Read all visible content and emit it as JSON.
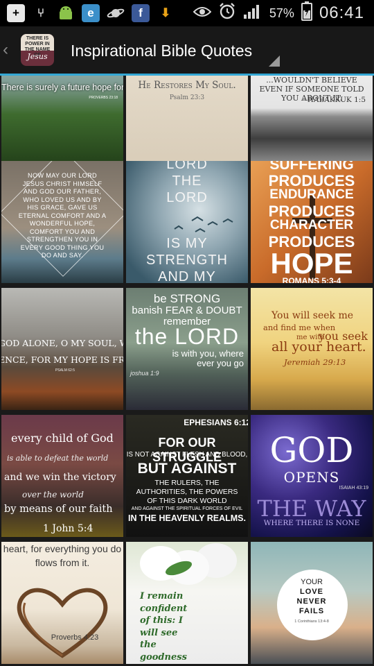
{
  "status_bar": {
    "icons_left": [
      "add-icon",
      "usb-icon",
      "android-debug-icon",
      "browser-icon",
      "planet-icon",
      "facebook-icon",
      "download-icon"
    ],
    "icons_right": [
      "eye-icon",
      "alarm-icon",
      "signal-icon",
      "battery-icon"
    ],
    "battery_percent": "57%",
    "time": "06:41"
  },
  "action_bar": {
    "logo_top": "THERE IS POWER IN THE NAME OF",
    "logo_bottom": "Jesus",
    "title": "Inspirational Bible Quotes"
  },
  "tiles": [
    {
      "t1": "There is surely a future hope for you",
      "t2": "PROVERBS 23:18"
    },
    {
      "t1": "He Restores My Soul.",
      "t2": "Psalm 23:3"
    },
    {
      "t1": "...WOULDN'T BELIEVE EVEN IF SOMEONE TOLD YOU ABOUT IT.",
      "t2": "- HABAKKUK 1:5"
    },
    {
      "t1": "NOW MAY OUR LORD JESUS CHRIST HIMSELF AND GOD OUR FATHER, WHO LOVED US AND BY HIS GRACE, GAVE US ETERNAL COMFORT AND A WONDERFUL HOPE, COMFORT YOU AND STRENGTHEN YOU IN EVERY GOOD THING YOU DO AND SAY."
    },
    {
      "t1": "LORD",
      "t2": "THE",
      "t3": "LORD",
      "t4": "IS MY",
      "t5": "STRENGTH",
      "t6": "AND MY"
    },
    {
      "t1": "SUFFERING",
      "t2": "PRODUCES",
      "t3": "ENDURANCE",
      "t4": "PRODUCES",
      "t5": "CHARACTER",
      "t6": "PRODUCES",
      "t7": "HOPE",
      "t8": "ROMANS 5:3-4"
    },
    {
      "t1": "GOD ALONE, O MY SOUL, WAIT",
      "t2": "ENCE, FOR MY HOPE IS FROM",
      "t3": "PSALM 62:5"
    },
    {
      "t1": "be STRONG",
      "t2": "banish FEAR & DOUBT",
      "t3": "remember",
      "t4": "the LORD",
      "t5": "is with you, where ever you go",
      "t6": "joshua 1:9"
    },
    {
      "t1": "You will seek me",
      "t2": "and find me when",
      "t3": "you seek",
      "t4": "me with",
      "t5": "all your heart.",
      "t6": "Jeremiah 29:13"
    },
    {
      "t1": "every child of God",
      "t2": "is able to defeat the world",
      "t3": "and we win the victory",
      "t4": "over the world",
      "t5": "by means of our faith",
      "t6": "1 John 5:4"
    },
    {
      "t1": "EPHESIANS 6:12",
      "t2": "FOR OUR STRUGGLE",
      "t3": "IS NOT AGAINST FLESH AND BLOOD,",
      "t4": "BUT AGAINST",
      "t5": "THE RULERS, THE AUTHORITIES, THE POWERS OF THIS DARK WORLD",
      "t6": "AND AGAINST THE SPIRITUAL FORCES OF EVIL",
      "t7": "IN THE HEAVENLY REALMS."
    },
    {
      "t1": "GOD",
      "t2": "OPENS",
      "t3": "ISAIAH 43:19",
      "t4": "THE WAY",
      "t5": "WHERE THERE IS NONE"
    },
    {
      "t1": "heart, for everything you do",
      "t2": "flows from it.",
      "t3": "Proverbs 4:23"
    },
    {
      "t1": "I remain confident of this: I will see the goodness of the Lord in"
    },
    {
      "t1": "YOUR",
      "t2": "LOVE",
      "t3": "NEVER",
      "t4": "FAILS",
      "t5": "1 Corinthians 13:4-8"
    }
  ]
}
